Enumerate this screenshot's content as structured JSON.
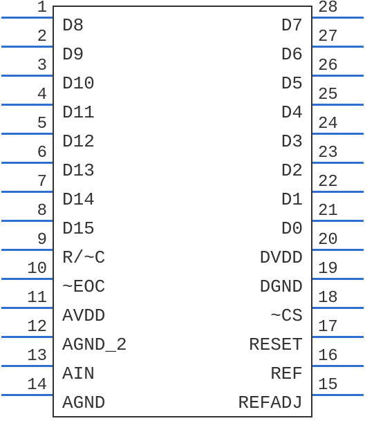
{
  "chip": {
    "left_pins": [
      {
        "num": "1",
        "label": "D8"
      },
      {
        "num": "2",
        "label": "D9"
      },
      {
        "num": "3",
        "label": "D10"
      },
      {
        "num": "4",
        "label": "D11"
      },
      {
        "num": "5",
        "label": "D12"
      },
      {
        "num": "6",
        "label": "D13"
      },
      {
        "num": "7",
        "label": "D14"
      },
      {
        "num": "8",
        "label": "D15"
      },
      {
        "num": "9",
        "label": "R/~C"
      },
      {
        "num": "10",
        "label": "~EOC"
      },
      {
        "num": "11",
        "label": "AVDD"
      },
      {
        "num": "12",
        "label": "AGND_2"
      },
      {
        "num": "13",
        "label": "AIN"
      },
      {
        "num": "14",
        "label": "AGND"
      }
    ],
    "right_pins": [
      {
        "num": "28",
        "label": "D7"
      },
      {
        "num": "27",
        "label": "D6"
      },
      {
        "num": "26",
        "label": "D5"
      },
      {
        "num": "25",
        "label": "D4"
      },
      {
        "num": "24",
        "label": "D3"
      },
      {
        "num": "23",
        "label": "D2"
      },
      {
        "num": "22",
        "label": "D1"
      },
      {
        "num": "21",
        "label": "D0"
      },
      {
        "num": "20",
        "label": "DVDD"
      },
      {
        "num": "19",
        "label": "DGND"
      },
      {
        "num": "18",
        "label": "~CS"
      },
      {
        "num": "17",
        "label": "RESET"
      },
      {
        "num": "16",
        "label": "REF"
      },
      {
        "num": "15",
        "label": "REFADJ"
      }
    ]
  }
}
